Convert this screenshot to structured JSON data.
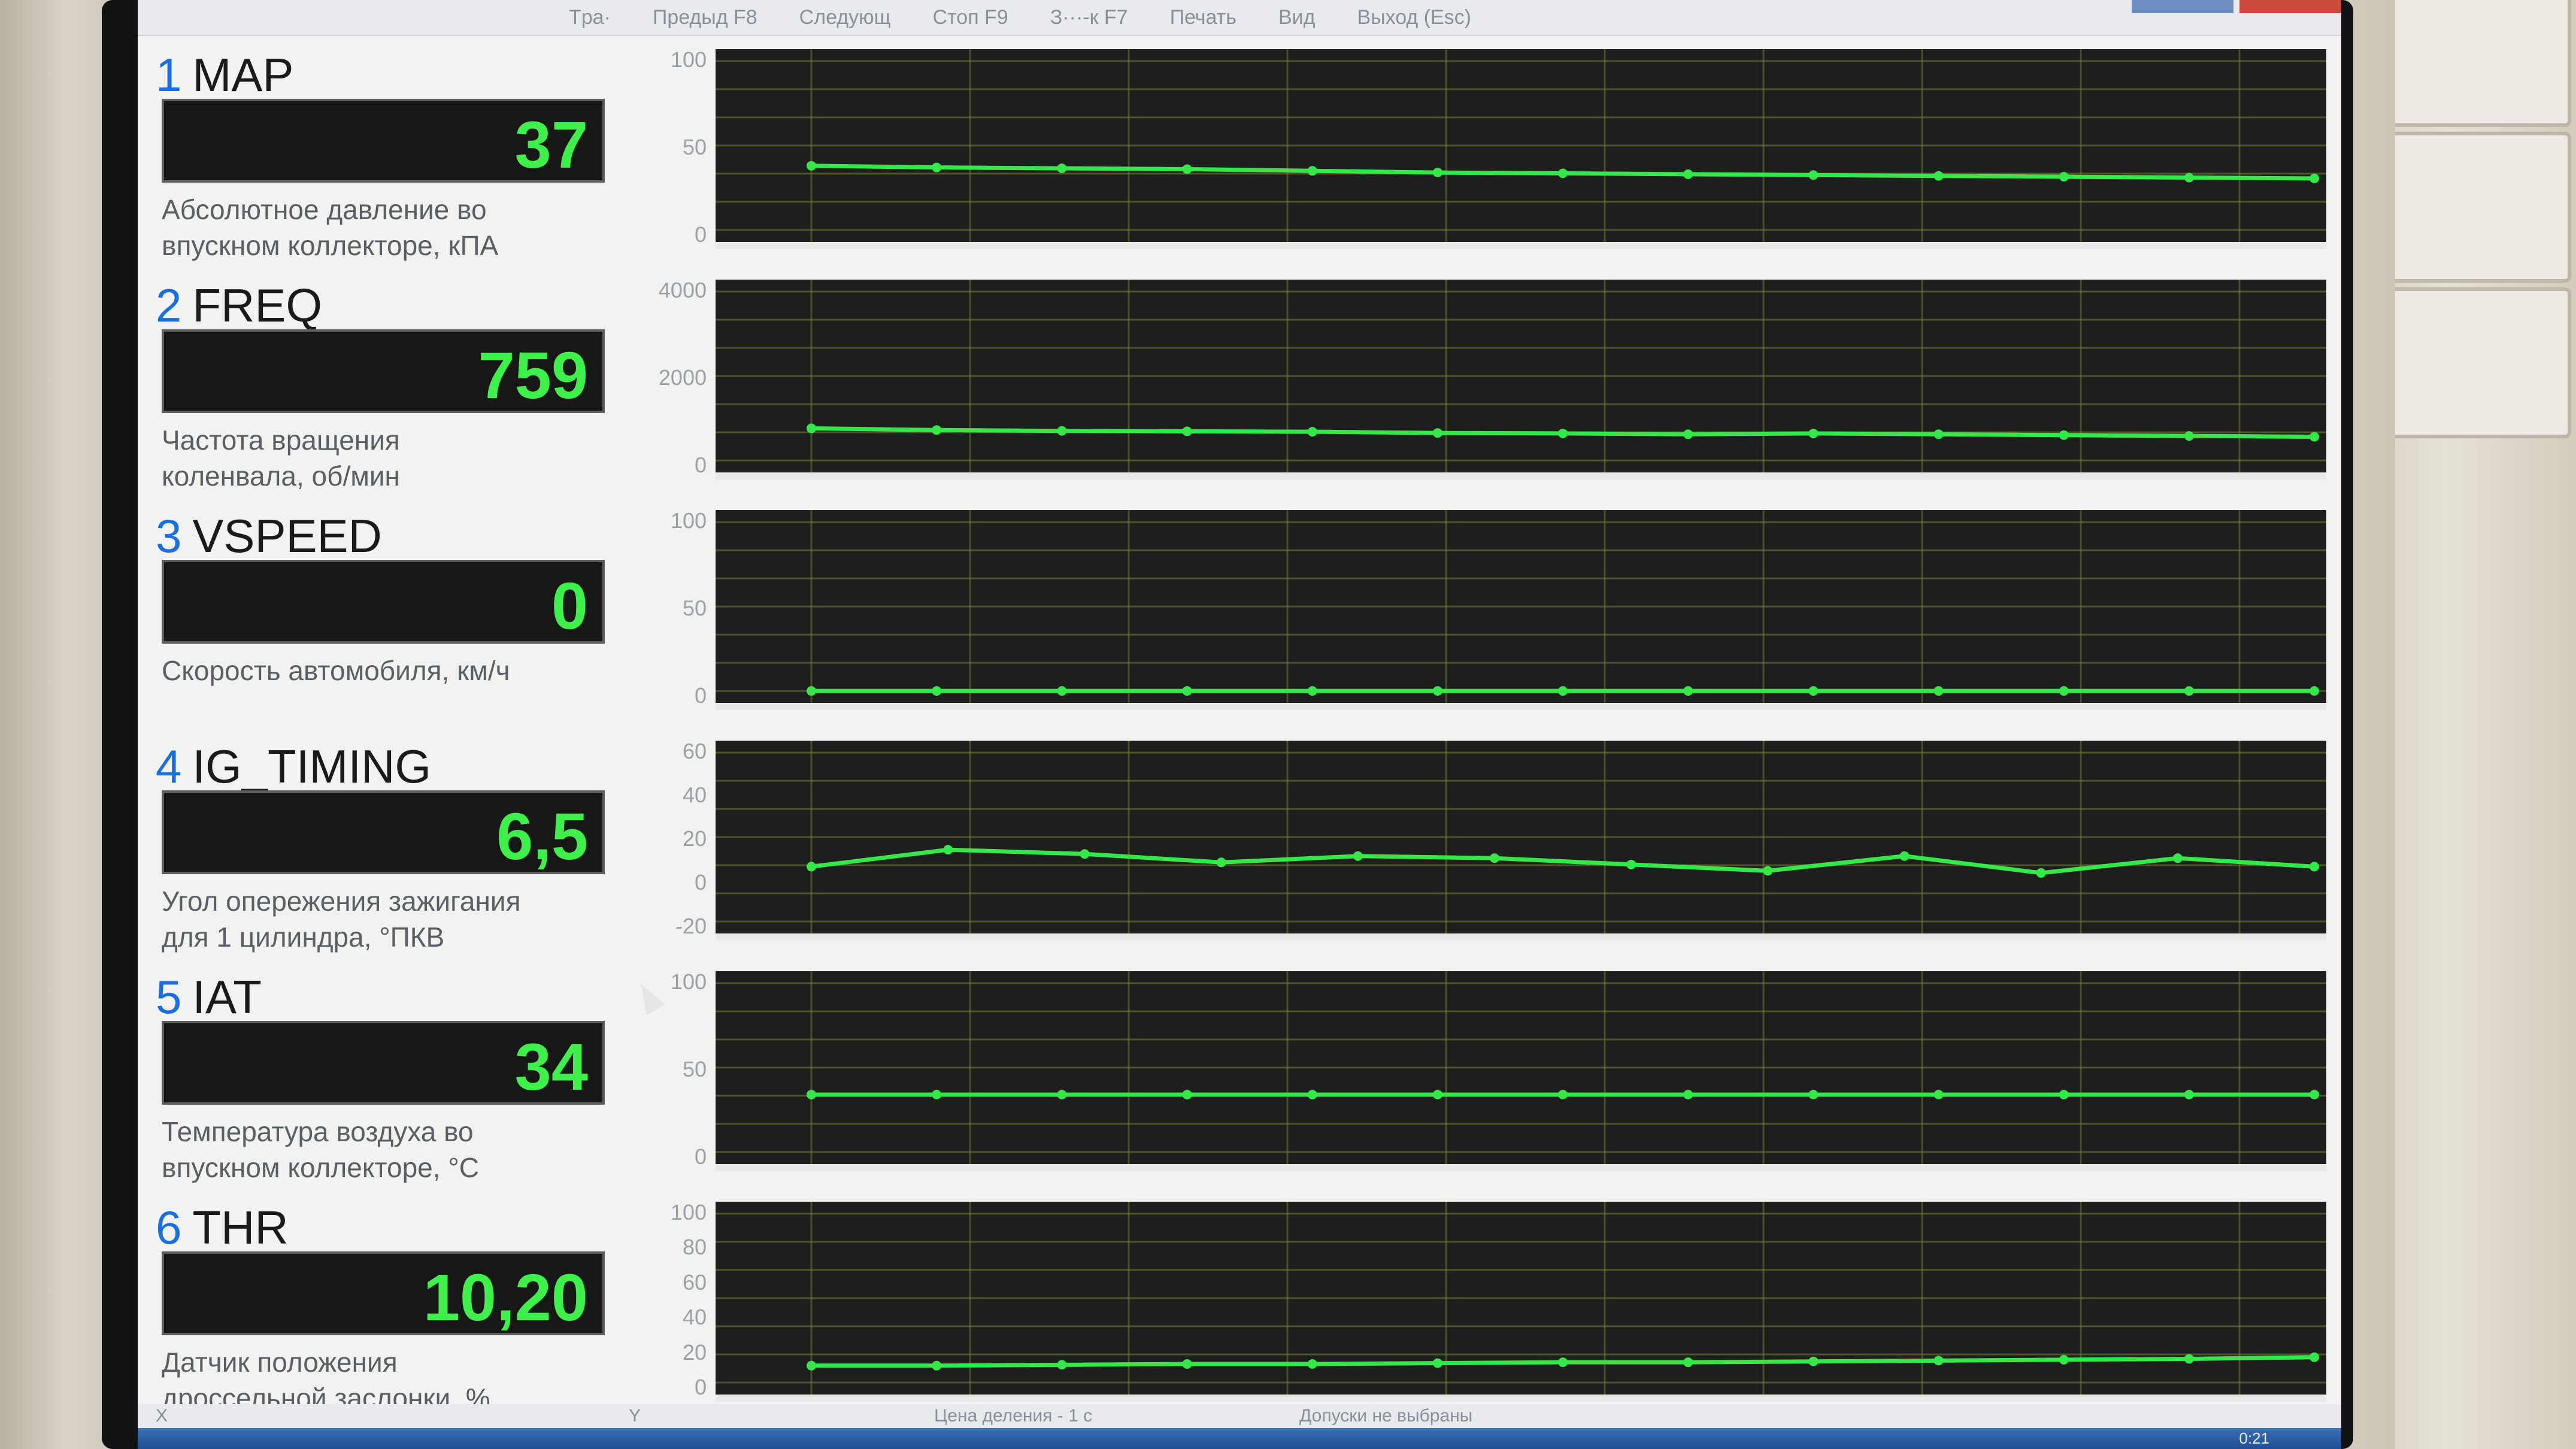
{
  "menu": [
    "Tpa·",
    "Предыд F8",
    "Следующ",
    "Стоп F9",
    "З···-к F7",
    "Печать",
    "Вид",
    "Выход (Esc)"
  ],
  "colors": {
    "trace": "#35e84a",
    "grid": "#7b7d3a",
    "readout": "#3ef04a",
    "channel_number": "#1a6fe0"
  },
  "panels": [
    {
      "num": "1",
      "name": "MAP",
      "value": "37",
      "desc1": "Абсолютное давление во",
      "desc2": "впускном коллекторе, кПА",
      "axis": [
        "100",
        "50",
        "0"
      ],
      "ymin": 0,
      "ymax": 100,
      "points": [
        38,
        37,
        36.5,
        36,
        35,
        34,
        33.5,
        33,
        32.5,
        32,
        31.5,
        31,
        30.5
      ]
    },
    {
      "num": "2",
      "name": "FREQ",
      "value": "759",
      "desc1": "Частота вращения",
      "desc2": "коленвала, об/мин",
      "axis": [
        "4000",
        "2000",
        "0"
      ],
      "ymin": 0,
      "ymax": 4000,
      "points": [
        760,
        720,
        700,
        690,
        680,
        650,
        640,
        620,
        640,
        620,
        600,
        580,
        560
      ]
    },
    {
      "num": "3",
      "name": "VSPEED",
      "value": "0",
      "desc1": "Скорость автомобиля, км/ч",
      "desc2": "",
      "axis": [
        "100",
        "50",
        "0"
      ],
      "ymin": 0,
      "ymax": 100,
      "points": [
        0,
        0,
        0,
        0,
        0,
        0,
        0,
        0,
        0,
        0,
        0,
        0,
        0
      ]
    },
    {
      "num": "4",
      "name": "IG_TIMING",
      "value": "6,5",
      "desc1": "Угол опережения зажигания",
      "desc2": "для 1 цилиндра, °ПКВ",
      "axis": [
        "60",
        "40",
        "20",
        "0",
        "-20"
      ],
      "ymin": -20,
      "ymax": 60,
      "points": [
        6,
        14,
        12,
        8,
        11,
        10,
        7,
        4,
        11,
        3,
        10,
        6
      ]
    },
    {
      "num": "5",
      "name": "IAT",
      "value": "34",
      "desc1": "Температура воздуха во",
      "desc2": "впускном коллекторе, °С",
      "axis": [
        "100",
        "50",
        "0"
      ],
      "ymin": 0,
      "ymax": 100,
      "points": [
        34,
        34,
        34,
        34,
        34,
        34,
        34,
        34,
        34,
        34,
        34,
        34,
        34
      ]
    },
    {
      "num": "6",
      "name": "THR",
      "value": "10,20",
      "desc1": "Датчик положения",
      "desc2": "дроссельной заслонки, %",
      "axis": [
        "100",
        "80",
        "60",
        "40",
        "20",
        "0"
      ],
      "ymin": 0,
      "ymax": 100,
      "points": [
        10,
        10,
        10.5,
        11,
        11,
        11.5,
        12,
        12,
        12.5,
        13,
        13.5,
        14,
        15
      ]
    }
  ],
  "status": {
    "x": "X",
    "y": "Y",
    "scale": "Цена деления - 1 с",
    "tolerance": "Допуски не выбраны"
  },
  "clock": "0:21"
}
